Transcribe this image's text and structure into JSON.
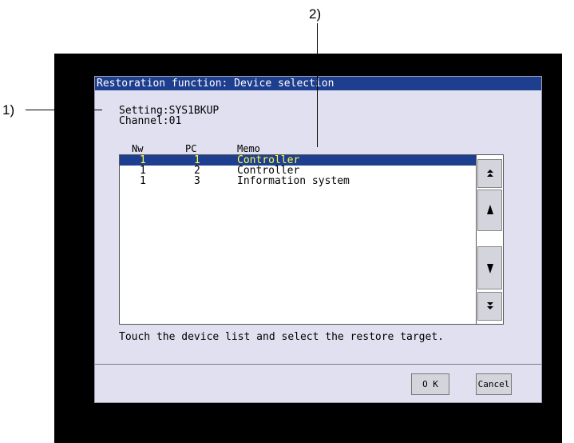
{
  "callouts": {
    "one": "1)",
    "two": "2)"
  },
  "dialog": {
    "title": "Restoration function: Device selection",
    "setting": "Setting:SYS1BKUP",
    "channel": "Channel:01",
    "headers": {
      "nw": "Nw",
      "pc": "PC",
      "memo": "Memo"
    },
    "rows": [
      {
        "nw": "1",
        "pc": "1",
        "memo": "Controller",
        "selected": true
      },
      {
        "nw": "1",
        "pc": "2",
        "memo": "Controller",
        "selected": false
      },
      {
        "nw": "1",
        "pc": "3",
        "memo": "Information system",
        "selected": false
      }
    ],
    "message": "Touch the device list and select the restore target.",
    "ok_label": "O K",
    "cancel_label": "Cancel"
  },
  "scroll_icons": {
    "top": "double-up-arrow",
    "up": "up-arrow",
    "down": "down-arrow",
    "bottom": "double-down-arrow"
  },
  "colors": {
    "title_bar": "#1e3f8f",
    "selection_bg": "#1e3f8f",
    "selection_text": "#ffff40",
    "dialog_bg": "#e0e0f0"
  }
}
